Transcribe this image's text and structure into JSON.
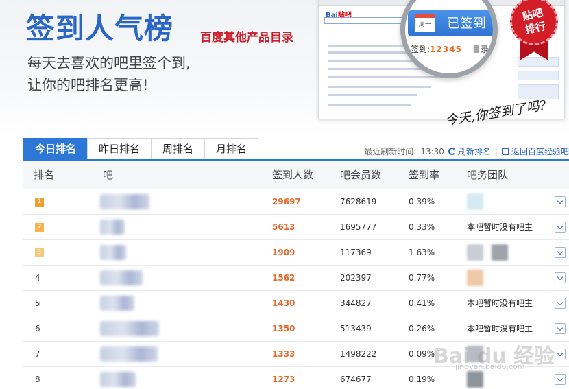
{
  "banner": {
    "title": "签到人气榜",
    "other_products_link": "百度其他产品目录",
    "desc_line1": "每天去喜欢的吧里签个到,",
    "desc_line2": "让你的吧排名更高!",
    "signed_button": "已签到",
    "calendar_label": "周一",
    "sign_count_label": "签到:",
    "sign_count_value": "12345",
    "directory_label": "目录",
    "ribbon_line1": "贴吧",
    "ribbon_line2": "排行",
    "handwriting": "今天,你签到了吗?",
    "mock_logo": "Bai",
    "mock_logo_tail": "贴吧"
  },
  "tabs": [
    {
      "label": "今日排名",
      "active": true
    },
    {
      "label": "昨日排名",
      "active": false
    },
    {
      "label": "周排名",
      "active": false
    },
    {
      "label": "月排名",
      "active": false
    }
  ],
  "refresh": {
    "label": "最近刷新时间:",
    "time": "13:30",
    "refresh_link": "刷新排名",
    "return_link": "返回百度经验吧"
  },
  "table": {
    "headers": {
      "rank": "排名",
      "name": "吧",
      "signins": "签到人数",
      "members": "吧会员数",
      "rate": "签到率",
      "team": "吧务团队"
    },
    "rows": [
      {
        "rank": "1",
        "signins": "29697",
        "members": "7628619",
        "rate": "0.39%",
        "team": ""
      },
      {
        "rank": "2",
        "signins": "5613",
        "members": "1695777",
        "rate": "0.33%",
        "team": "本吧暂时没有吧主"
      },
      {
        "rank": "3",
        "signins": "1909",
        "members": "117369",
        "rate": "1.63%",
        "team": ""
      },
      {
        "rank": "4",
        "signins": "1562",
        "members": "202397",
        "rate": "0.77%",
        "team": ""
      },
      {
        "rank": "5",
        "signins": "1430",
        "members": "344827",
        "rate": "0.41%",
        "team": "本吧暂时没有吧主"
      },
      {
        "rank": "6",
        "signins": "1350",
        "members": "513439",
        "rate": "0.26%",
        "team": "本吧暂时没有吧主"
      },
      {
        "rank": "7",
        "signins": "1333",
        "members": "1498222",
        "rate": "0.09%",
        "team": ""
      },
      {
        "rank": "8",
        "signins": "1273",
        "members": "674677",
        "rate": "0.19%",
        "team": ""
      }
    ]
  },
  "colors": {
    "accent": "#2d77d6",
    "title_blue": "#2a67c4",
    "link_red": "#cc1f2a",
    "signin_orange": "#e8672a",
    "rank1": "#f0a030",
    "rank2": "#f5b34c",
    "rank3": "#f8c77a"
  },
  "watermark": {
    "text": "Bai du 经验",
    "sub": "jingyan.baidu.com"
  }
}
